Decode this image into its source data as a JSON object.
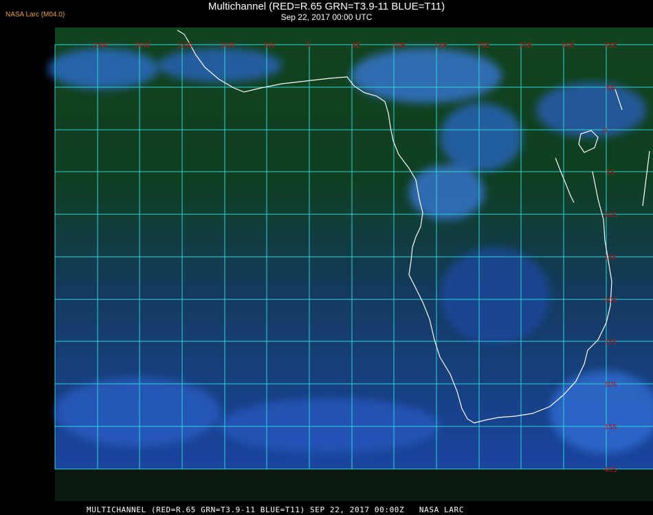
{
  "header": {
    "brand": "NASA Larc (M04.0)",
    "title": "Multichannel (RED=R.65 GRN=T3.9-11 BLUE=T11)",
    "subtitle": "Sep 22, 2017 00:00 UTC"
  },
  "map": {
    "grid_color": "#2fd6d6",
    "coast_color": "#ffffff",
    "label_color": "#b01818",
    "lon_labels": [
      "25W",
      "20W",
      "15W",
      "10W",
      "5W",
      "0",
      "5E",
      "10E",
      "15E",
      "20E",
      "25E",
      "30E",
      "35E"
    ],
    "lat_labels": [
      "5N",
      "0",
      "5S",
      "10S",
      "15S",
      "20S",
      "25S",
      "30S",
      "35S",
      "40S"
    ]
  },
  "footer": {
    "text": "MULTICHANNEL (RED=R.65 GRN=T3.9-11 BLUE=T11) SEP 22, 2017 00:00Z   NASA LARC"
  }
}
